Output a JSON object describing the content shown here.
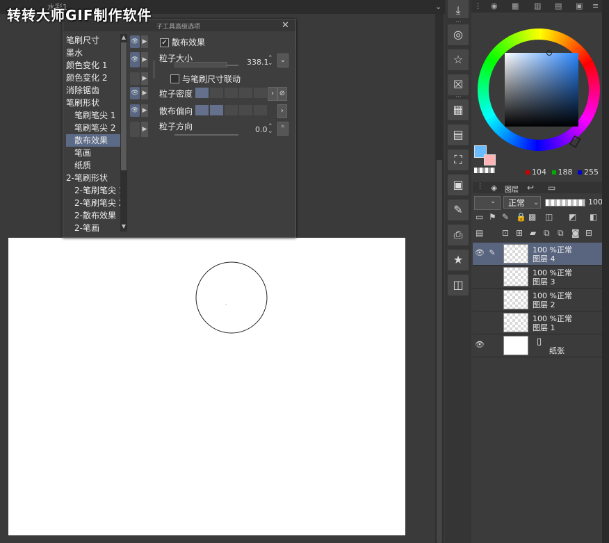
{
  "watermark": "转转大师GIF制作软件",
  "top_tab": "水彩1",
  "dialog": {
    "title": "子工具高级选项",
    "categories": [
      {
        "label": "笔刷尺寸",
        "sub": false
      },
      {
        "label": "墨水",
        "sub": false
      },
      {
        "label": "颜色变化 1",
        "sub": false
      },
      {
        "label": "颜色变化 2",
        "sub": false
      },
      {
        "label": "消除锯齿",
        "sub": false
      },
      {
        "label": "笔刷形状",
        "sub": false
      },
      {
        "label": "笔刷笔尖 1",
        "sub": true
      },
      {
        "label": "笔刷笔尖 2",
        "sub": true
      },
      {
        "label": "散布效果",
        "sub": true,
        "selected": true
      },
      {
        "label": "笔画",
        "sub": true
      },
      {
        "label": "纸质",
        "sub": true
      },
      {
        "label": "2-笔刷形状",
        "sub": false
      },
      {
        "label": "2-笔刷笔尖 1",
        "sub": true
      },
      {
        "label": "2-笔刷笔尖 2",
        "sub": true
      },
      {
        "label": "2-散布效果",
        "sub": true
      },
      {
        "label": "2-笔画",
        "sub": true
      }
    ],
    "scatter_effect_label": "散布效果",
    "particle_size_label": "粒子大小",
    "particle_size_value": "338.1",
    "link_brush_size_label": "与笔刷尺寸联动",
    "particle_density_label": "粒子密度",
    "particle_density_level": 1,
    "scatter_bias_label": "散布偏向",
    "scatter_bias_level": 2,
    "particle_direction_label": "粒子方向",
    "particle_direction_value": "0.0"
  },
  "color": {
    "fg": "#68bcff",
    "bg": "#ffb5b5",
    "r": "104",
    "g": "188",
    "b": "255"
  },
  "layers_panel": {
    "tab_label": "图层",
    "blend_mode": "正常",
    "opacity": "100",
    "layers": [
      {
        "line1": "100 %正常",
        "line2": "图层 4",
        "selected": true,
        "visible": true
      },
      {
        "line1": "100 %正常",
        "line2": "图层 3",
        "selected": false,
        "visible": false
      },
      {
        "line1": "100 %正常",
        "line2": "图层 2",
        "selected": false,
        "visible": false
      },
      {
        "line1": "100 %正常",
        "line2": "图层 1",
        "selected": false,
        "visible": false
      }
    ],
    "paper_label": "纸张"
  }
}
